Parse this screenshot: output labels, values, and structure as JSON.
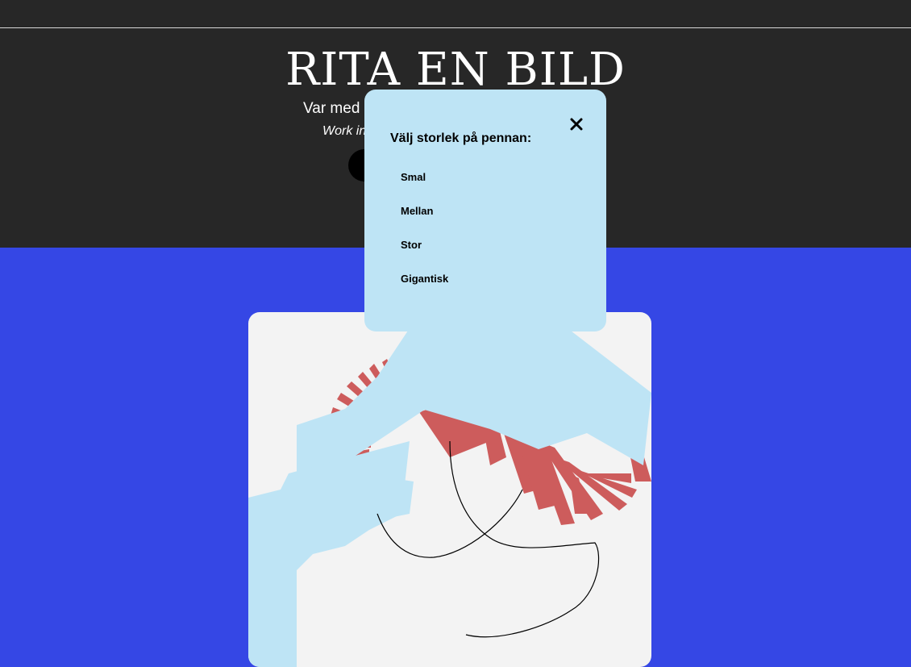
{
  "header": {
    "title": "RITA EN BILD",
    "subtitle": "Var med",
    "work_in_progress": "Work in"
  },
  "modal": {
    "heading": "Välj storlek på pennan:",
    "close_icon": "close-icon",
    "sizes": [
      "Smal",
      "Mellan",
      "Stor",
      "Gigantisk"
    ]
  },
  "colors": {
    "page_background": "#3547e5",
    "header_background": "#272727",
    "canvas_background": "#f3f3f3",
    "modal_background": "#bee4f5",
    "stroke_light_blue": "#bee4f5",
    "stroke_red": "#cd5c5c",
    "stroke_black": "#000000"
  }
}
